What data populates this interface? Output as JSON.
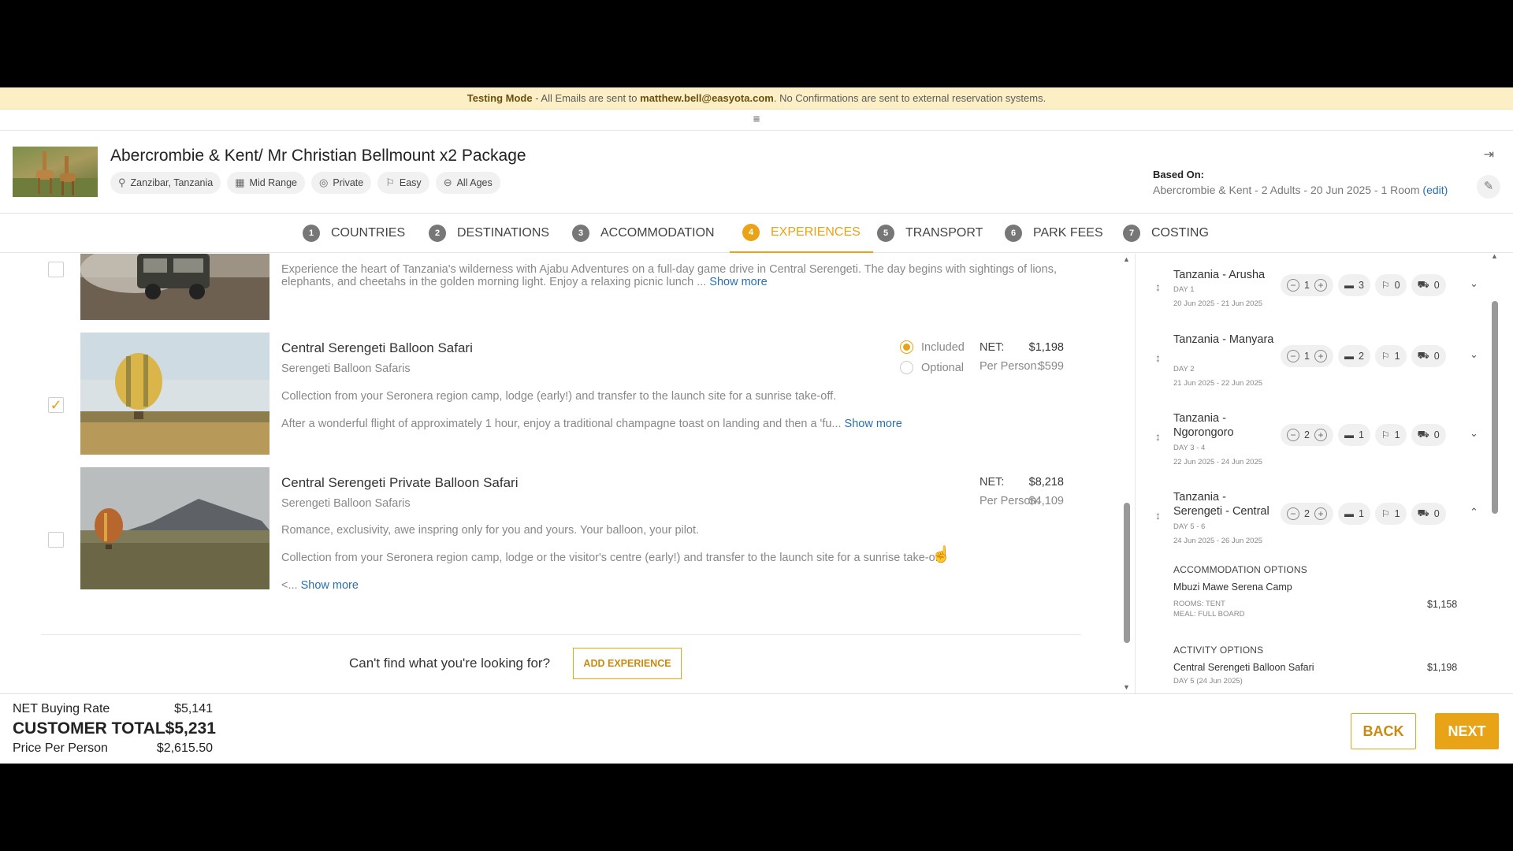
{
  "banner": {
    "mode": "Testing Mode",
    "text1": " - All Emails are sent to ",
    "email": "matthew.bell@easyota.com",
    "text2": ". No Confirmations are sent to external reservation systems."
  },
  "menu_icon": "≡",
  "package": {
    "title": "Abercrombie & Kent/ Mr Christian Bellmount x2 Package",
    "chips": [
      {
        "icon": "location-pin-icon",
        "label": "Zanzibar, Tanzania"
      },
      {
        "icon": "hotel-icon",
        "label": "Mid Range"
      },
      {
        "icon": "eye-off-icon",
        "label": "Private"
      },
      {
        "icon": "hiker-icon",
        "label": "Easy"
      },
      {
        "icon": "minus-circle-icon",
        "label": "All Ages"
      }
    ],
    "based_on_label": "Based On:",
    "based_on_value": "Abercrombie & Kent - 2 Adults - 20 Jun 2025 - 1 Room",
    "edit_link": "(edit)"
  },
  "steps": [
    {
      "num": "1",
      "label": "COUNTRIES"
    },
    {
      "num": "2",
      "label": "DESTINATIONS"
    },
    {
      "num": "3",
      "label": "ACCOMMODATION"
    },
    {
      "num": "4",
      "label": "EXPERIENCES",
      "active": true
    },
    {
      "num": "5",
      "label": "TRANSPORT"
    },
    {
      "num": "6",
      "label": "PARK FEES"
    },
    {
      "num": "7",
      "label": "COSTING"
    }
  ],
  "experiences": {
    "first": {
      "desc": "Experience the heart of Tanzania's wilderness with Ajabu Adventures on a full-day game drive in Central Serengeti. The day begins with sightings of lions,",
      "desc2": "elephants, and cheetahs in the golden morning light. Enjoy a relaxing picnic lunch ...",
      "more": "Show more"
    },
    "balloon": {
      "title": "Central Serengeti Balloon Safari",
      "provider": "Serengeti Balloon Safaris",
      "desc1": "Collection from your Seronera region camp, lodge (early!) and transfer to the launch site for a sunrise take-off.",
      "desc2": "After a wonderful flight of approximately 1 hour, enjoy a traditional champagne toast on landing and then a 'fu...",
      "more": "Show more",
      "included": "Included",
      "optional": "Optional",
      "net_label": "NET:",
      "net": "$1,198",
      "pp_label": "Per Person:",
      "pp": "$599"
    },
    "private": {
      "title": "Central Serengeti Private Balloon Safari",
      "provider": "Serengeti Balloon Safaris",
      "desc1": "Romance, exclusivity, awe inspring only for you and yours. Your balloon, your pilot.",
      "desc2": "Collection from your Seronera region camp, lodge or the visitor's centre (early!) and transfer to the launch site for a sunrise take-off.",
      "desc3": "<...",
      "more": "Show more",
      "net_label": "NET:",
      "net": "$8,218",
      "pp_label": "Per Person:",
      "pp": "$4,109"
    },
    "cant_find": "Can't find what you're looking for?",
    "add_button": "ADD EXPERIENCE"
  },
  "sidebar": {
    "destinations": [
      {
        "name": "Tanzania - Arusha",
        "day": "DAY 1",
        "dates": "20 Jun 2025 - 21 Jun 2025",
        "nights": "1",
        "beds": "3",
        "activities": "0",
        "transport": "0"
      },
      {
        "name": "Tanzania - Manyara",
        "day": "DAY 2",
        "dates": "21 Jun 2025 - 22 Jun 2025",
        "nights": "1",
        "beds": "2",
        "activities": "1",
        "transport": "0"
      },
      {
        "name": "Tanzania - Ngorongoro",
        "day": "DAY 3 - 4",
        "dates": "22 Jun 2025 - 24 Jun 2025",
        "nights": "2",
        "beds": "1",
        "activities": "1",
        "transport": "0"
      },
      {
        "name": "Tanzania - Serengeti - Central",
        "day": "DAY 5 - 6",
        "dates": "24 Jun 2025 - 26 Jun 2025",
        "nights": "2",
        "beds": "1",
        "activities": "1",
        "transport": "0"
      }
    ],
    "accommodation_header": "ACCOMMODATION OPTIONS",
    "accommodation": {
      "name": "Mbuzi Mawe Serena Camp",
      "rooms": "ROOMS: TENT",
      "meal": "MEAL: FULL BOARD",
      "price": "$1,158"
    },
    "activity_header": "ACTIVITY OPTIONS",
    "activity": {
      "name": "Central Serengeti Balloon Safari",
      "day": "DAY 5  (24 Jun 2025)",
      "price": "$1,198"
    }
  },
  "footer": {
    "net_label": "NET Buying Rate",
    "net_value": "$5,141",
    "total_label": "CUSTOMER TOTAL",
    "total_value": "$5,231",
    "pp_label": "Price Per Person",
    "pp_value": "$2,615.50",
    "back": "BACK",
    "next": "NEXT"
  },
  "colors": {
    "accent": "#e8a317",
    "link": "#2a6fb0",
    "banner": "#fcefc6"
  }
}
